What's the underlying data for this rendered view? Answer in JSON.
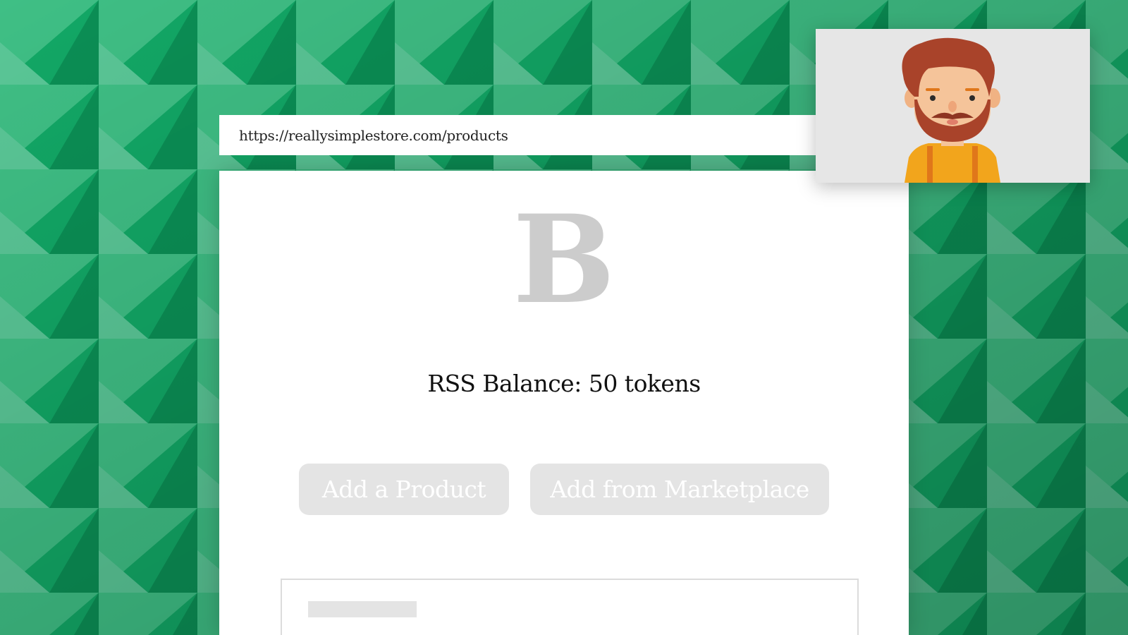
{
  "browser": {
    "url": "https://reallysimplestore.com/products"
  },
  "store": {
    "logo_letter": "B",
    "balance_text": "RSS Balance: 50 tokens",
    "buttons": {
      "add_product": "Add a Product",
      "add_marketplace": "Add from Marketplace"
    }
  },
  "colors": {
    "background_green": "#17a866",
    "button_gray": "#e4e4e4",
    "logo_gray": "#cccccc",
    "panel_gray": "#e6e6e6"
  },
  "icons": {
    "avatar": "bearded-man-avatar-icon"
  }
}
